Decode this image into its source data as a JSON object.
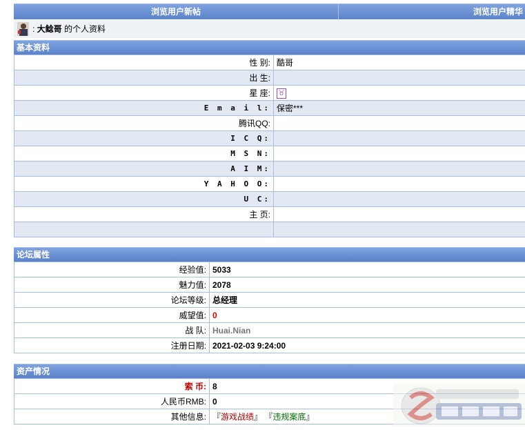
{
  "nav": {
    "tab1": "浏览用户新帖",
    "tab2": "浏览用户精华"
  },
  "user": {
    "name": "大鲶哥",
    "suffix": "的个人资料"
  },
  "basic": {
    "title": "基本资料",
    "rows": [
      {
        "label": "性 别:",
        "value": "酷哥"
      },
      {
        "label": "出 生:",
        "value": ""
      },
      {
        "label": "星 座:",
        "value": "♉"
      },
      {
        "label": "E m a i l:",
        "value": "保密***"
      },
      {
        "label": "腾讯QQ:",
        "value": ""
      },
      {
        "label": "I C Q:",
        "value": ""
      },
      {
        "label": "M S N:",
        "value": ""
      },
      {
        "label": "A I M:",
        "value": ""
      },
      {
        "label": "Y A H O O:",
        "value": ""
      },
      {
        "label": "U C:",
        "value": ""
      },
      {
        "label": "主 页:",
        "value": ""
      }
    ]
  },
  "forum": {
    "title": "论坛属性",
    "rows": [
      {
        "label": "经验值:",
        "value": "5033"
      },
      {
        "label": "魅力值:",
        "value": "2078"
      },
      {
        "label": "论坛等级:",
        "value": "总经理"
      },
      {
        "label": "威望值:",
        "value": "0"
      },
      {
        "label": "战 队:",
        "value": "Huai.Nian"
      },
      {
        "label": "注册日期:",
        "value": "2021-02-03 9:24:00"
      }
    ]
  },
  "assets": {
    "title": "资产情况",
    "rows": [
      {
        "label": "索 币:",
        "value": "8"
      },
      {
        "label": "人民币RMB:",
        "value": "0"
      },
      {
        "label": "其他信息:",
        "value": ""
      }
    ],
    "links": {
      "open1": "『",
      "link1": "游戏战绩",
      "close1": "』",
      "open2": "『",
      "link2": "违规案底",
      "close2": "』"
    }
  },
  "colors": {
    "header": "#6b8fd3",
    "row_alt": "#e3e9f3",
    "border": "#a8bedf"
  }
}
